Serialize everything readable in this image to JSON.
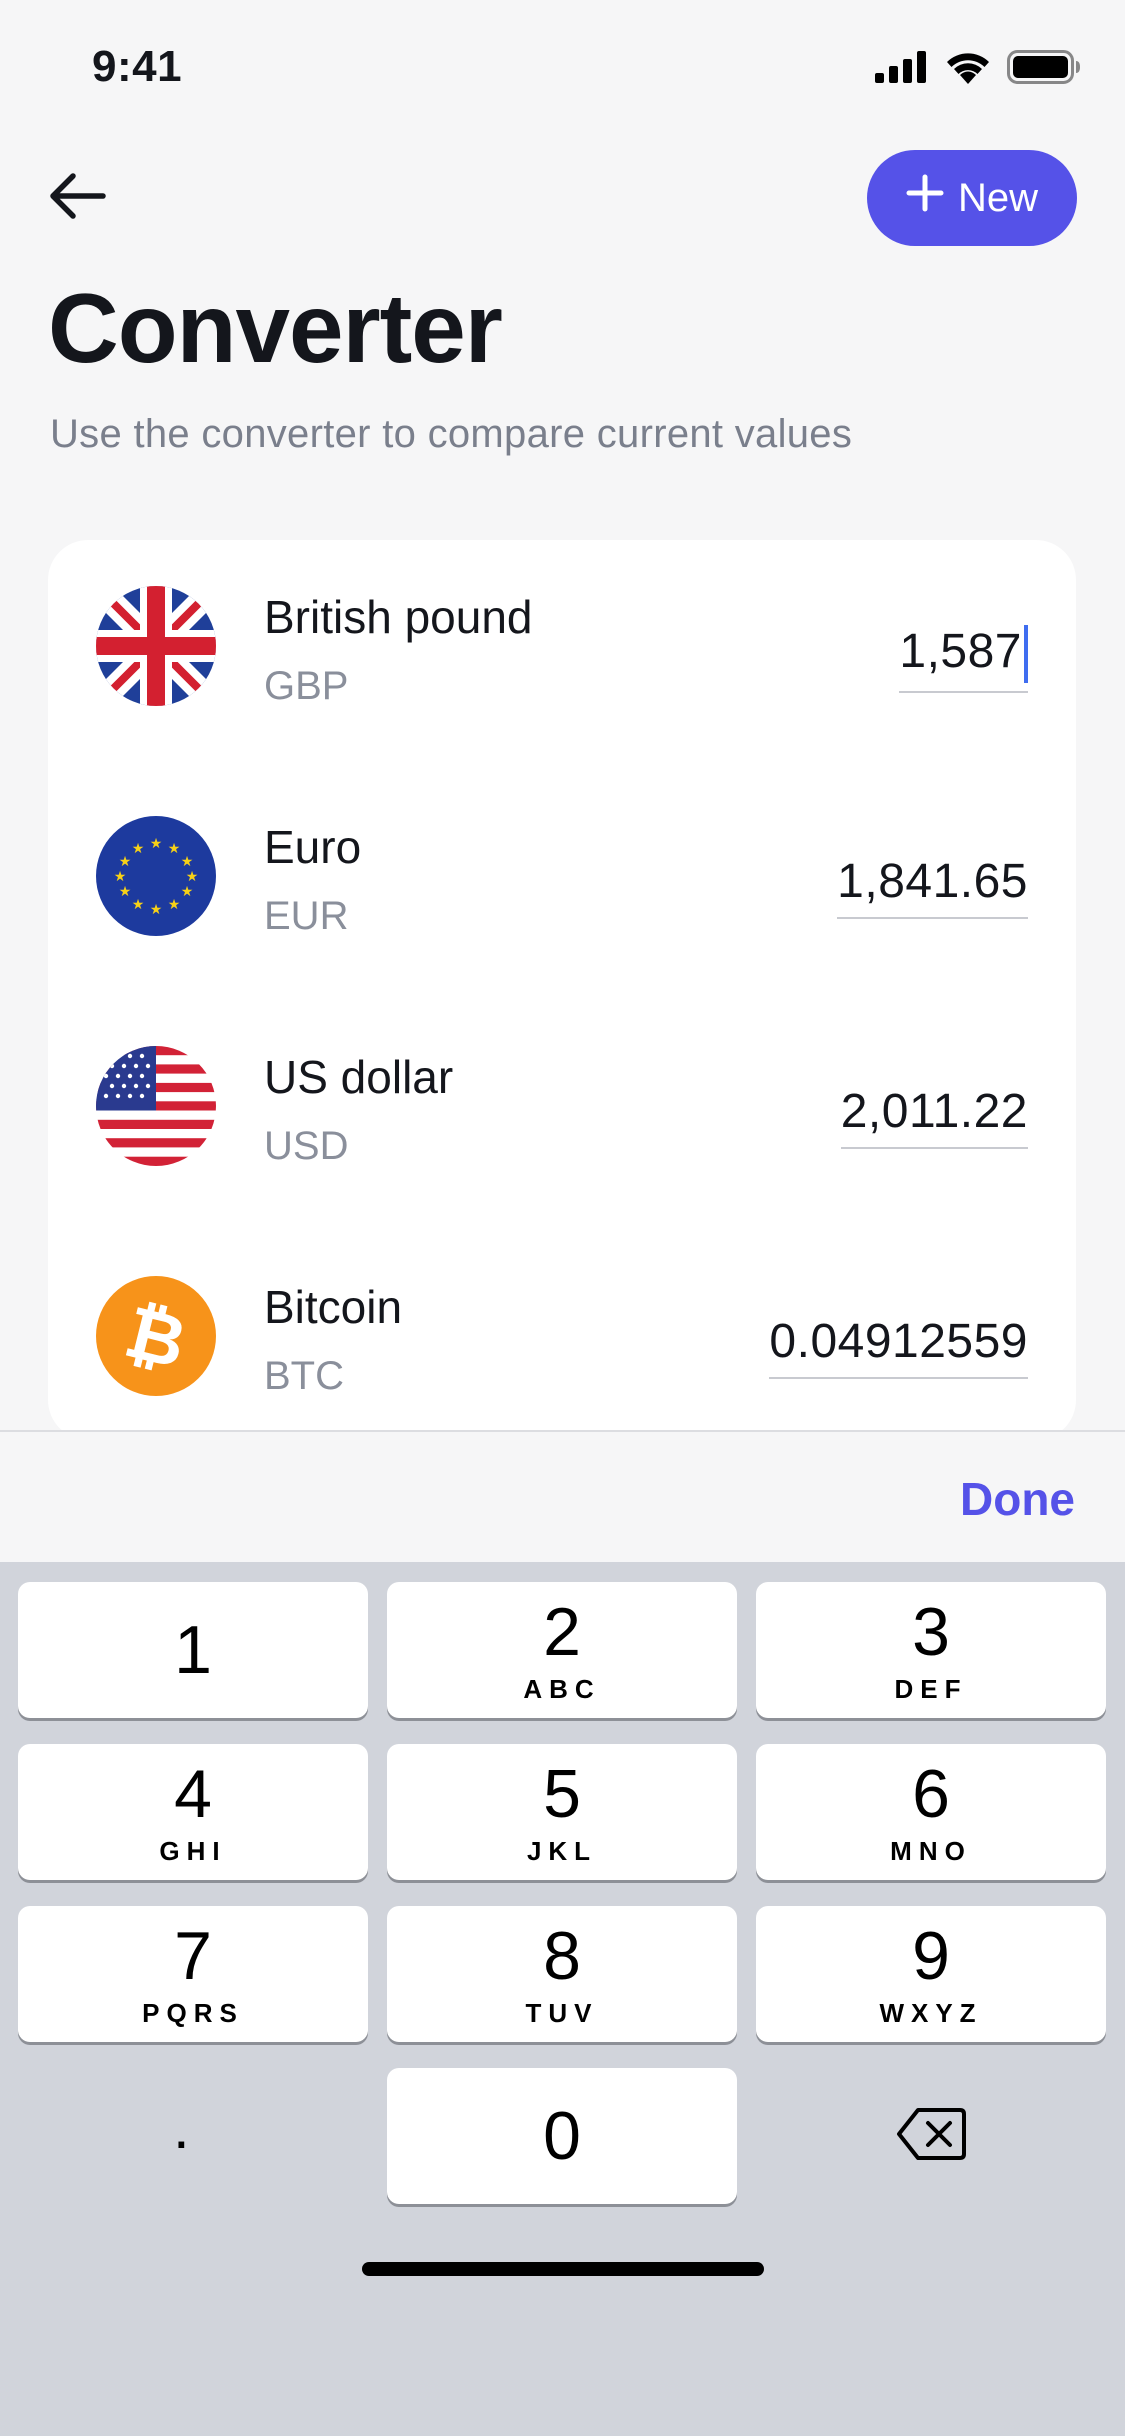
{
  "status_bar": {
    "time": "9:41",
    "icons": [
      "cellular-signal-icon",
      "wifi-icon",
      "battery-icon"
    ]
  },
  "header": {
    "back_icon": "arrow-left-icon",
    "new_button_label": "New",
    "new_button_icon": "plus-icon",
    "title": "Converter",
    "subtitle": "Use the converter to compare current values"
  },
  "currencies": [
    {
      "name": "British pound",
      "code": "GBP",
      "value": "1,587",
      "icon": "uk-flag-icon",
      "focused": true
    },
    {
      "name": "Euro",
      "code": "EUR",
      "value": "1,841.65",
      "icon": "eu-flag-icon",
      "focused": false
    },
    {
      "name": "US dollar",
      "code": "USD",
      "value": "2,011.22",
      "icon": "us-flag-icon",
      "focused": false
    },
    {
      "name": "Bitcoin",
      "code": "BTC",
      "value": "0.04912559",
      "icon": "bitcoin-icon",
      "focused": false
    }
  ],
  "keyboard": {
    "done_label": "Done",
    "keys": [
      {
        "digit": "1",
        "letters": ""
      },
      {
        "digit": "2",
        "letters": "ABC"
      },
      {
        "digit": "3",
        "letters": "DEF"
      },
      {
        "digit": "4",
        "letters": "GHI"
      },
      {
        "digit": "5",
        "letters": "JKL"
      },
      {
        "digit": "6",
        "letters": "MNO"
      },
      {
        "digit": "7",
        "letters": "PQRS"
      },
      {
        "digit": "8",
        "letters": "TUV"
      },
      {
        "digit": "9",
        "letters": "WXYZ"
      }
    ],
    "decimal_key": ".",
    "zero_key": "0",
    "delete_icon": "backspace-icon"
  },
  "colors": {
    "accent": "#5552e8",
    "background": "#f6f6f7",
    "card": "#ffffff",
    "keyboard_bg": "#d1d4db",
    "caret": "#3f6df0",
    "bitcoin": "#f7931a"
  }
}
